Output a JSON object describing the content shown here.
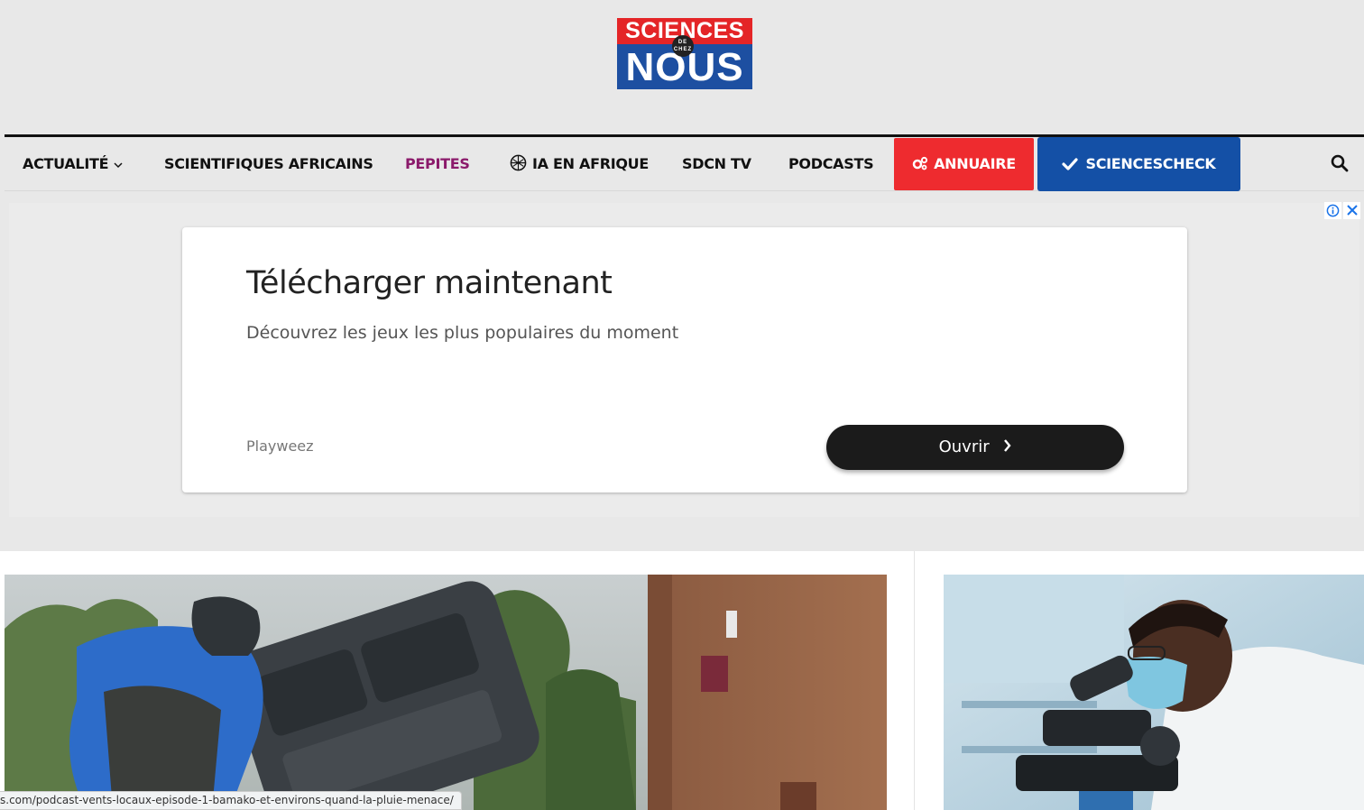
{
  "logo": {
    "line1": "SCIENCES",
    "small": "DE CHEZ",
    "line2": "NOUS"
  },
  "nav": {
    "items": [
      {
        "label": "ACTUALITÉ",
        "has_dropdown": true
      },
      {
        "label": "SCIENTIFIQUES AFRICAINS"
      },
      {
        "label": "PEPITES",
        "color": "#8b1a6b"
      },
      {
        "label": "IA EN AFRIQUE",
        "icon": "ai-chip-icon"
      },
      {
        "label": "SDCN TV"
      },
      {
        "label": "PODCASTS"
      }
    ],
    "annuaire": {
      "label": "ANNUAIRE",
      "icon": "gears-icon",
      "color": "#ee2b2f"
    },
    "sciencescheck": {
      "label": "SCIENCESCHECK",
      "icon": "check-icon",
      "color": "#1450a6"
    },
    "search_icon": "search-icon"
  },
  "ad": {
    "title": "Télécharger maintenant",
    "subtitle": "Découvrez les jeux les plus populaires du moment",
    "brand": "Playweez",
    "button": "Ouvrir",
    "info_icon": "info-icon",
    "close_icon": "close-icon"
  },
  "status_bar": {
    "url": "s.com/podcast-vents-locaux-episode-1-bamako-et-environs-quand-la-pluie-menace/"
  },
  "colors": {
    "brand_red": "#e42527",
    "brand_blue": "#1d4fa1"
  }
}
